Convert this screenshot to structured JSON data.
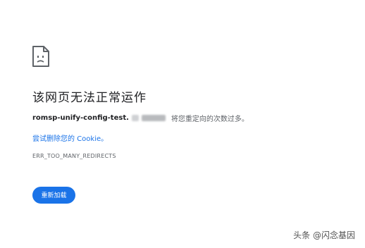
{
  "error": {
    "title": "该网页无法正常运作",
    "domain": "romsp-unify-config-test.",
    "message": "将您重定向的次数过多。",
    "cookie_link": "尝试删除您的 Cookie。",
    "code": "ERR_TOO_MANY_REDIRECTS",
    "icon": "sad-page-icon"
  },
  "actions": {
    "reload_label": "重新加载"
  },
  "watermark": {
    "text": "头条 @闪念基因"
  },
  "colors": {
    "accent": "#1a73e8",
    "title": "#202124",
    "secondary": "#5f6368"
  }
}
